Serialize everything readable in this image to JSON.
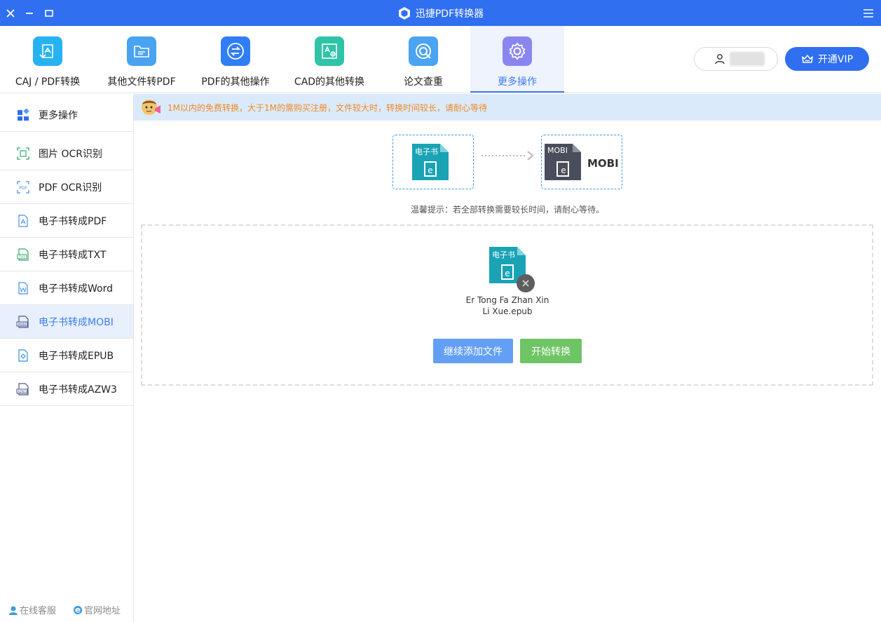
{
  "app": {
    "title": "迅捷PDF转换器"
  },
  "toolbar": {
    "tabs": [
      {
        "label": "CAJ / PDF转换",
        "color": "#27b3f2"
      },
      {
        "label": "其他文件转PDF",
        "color": "#49a3f0"
      },
      {
        "label": "PDF的其他操作",
        "color": "#2f7ef5"
      },
      {
        "label": "CAD的其他转换",
        "color": "#2fc4a8"
      },
      {
        "label": "论文查重",
        "color": "#4aa3f3"
      },
      {
        "label": "更多操作",
        "color": "#8a86f0"
      }
    ],
    "active_tab": "更多操作",
    "vip_label": "开通VIP"
  },
  "sidebar": {
    "items": [
      {
        "label": "更多操作"
      },
      {
        "label": "图片 OCR识别"
      },
      {
        "label": "PDF OCR识别"
      },
      {
        "label": "电子书转成PDF"
      },
      {
        "label": "电子书转成TXT"
      },
      {
        "label": "电子书转成Word"
      },
      {
        "label": "电子书转成MOBI"
      },
      {
        "label": "电子书转成EPUB"
      },
      {
        "label": "电子书转成AZW3"
      }
    ],
    "active_item": "电子书转成MOBI",
    "footer": {
      "service": "在线客服",
      "website": "官网地址"
    }
  },
  "notice": {
    "text": "1M以内的免费转换，大于1M的需购买注册，文件较大时，转换时间较长，请耐心等待"
  },
  "conversion": {
    "source_badge": "电子书",
    "target_badge": "MOBI",
    "target_label": "MOBI",
    "tip": "温馨提示：若全部转换需要较长时间，请耐心等待。"
  },
  "file": {
    "badge": "电子书",
    "name_line1": "Er Tong Fa Zhan Xin",
    "name_line2": "Li Xue.epub"
  },
  "buttons": {
    "add_files": "继续添加文件",
    "start": "开始转换"
  },
  "colors": {
    "brand": "#2f6ff0",
    "accent": "#3c7bf0",
    "ebook_teal": "#1aa3b5",
    "mobi_dark": "#4a4e5c",
    "notice_orange": "#f08a24",
    "start_green": "#6fc565",
    "add_blue": "#63a0f5"
  }
}
